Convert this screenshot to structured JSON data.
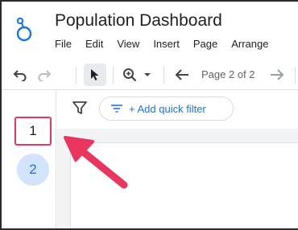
{
  "app": {
    "title": "Population Dashboard",
    "brand_color": "#1a73e8"
  },
  "menu": {
    "items": [
      "File",
      "Edit",
      "View",
      "Insert",
      "Page",
      "Arrange"
    ]
  },
  "toolbar": {
    "undo_icon": "undo-icon",
    "redo_icon": "redo-icon",
    "select_icon": "pointer-icon",
    "zoom_icon": "zoom-in-icon",
    "prev_icon": "arrow-left-icon",
    "next_icon": "arrow-right-icon",
    "page_label": "Page 2 of 2"
  },
  "filter_bar": {
    "icon": "filter-icon",
    "quick_filter_label": "+ Add quick filter"
  },
  "pages": {
    "items": [
      {
        "label": "1",
        "highlighted": true,
        "highlight_color": "#e8365f"
      },
      {
        "label": "2",
        "active": true,
        "active_color": "#d2e3fc"
      }
    ]
  },
  "annotation": {
    "arrow_color": "#e8365f"
  }
}
